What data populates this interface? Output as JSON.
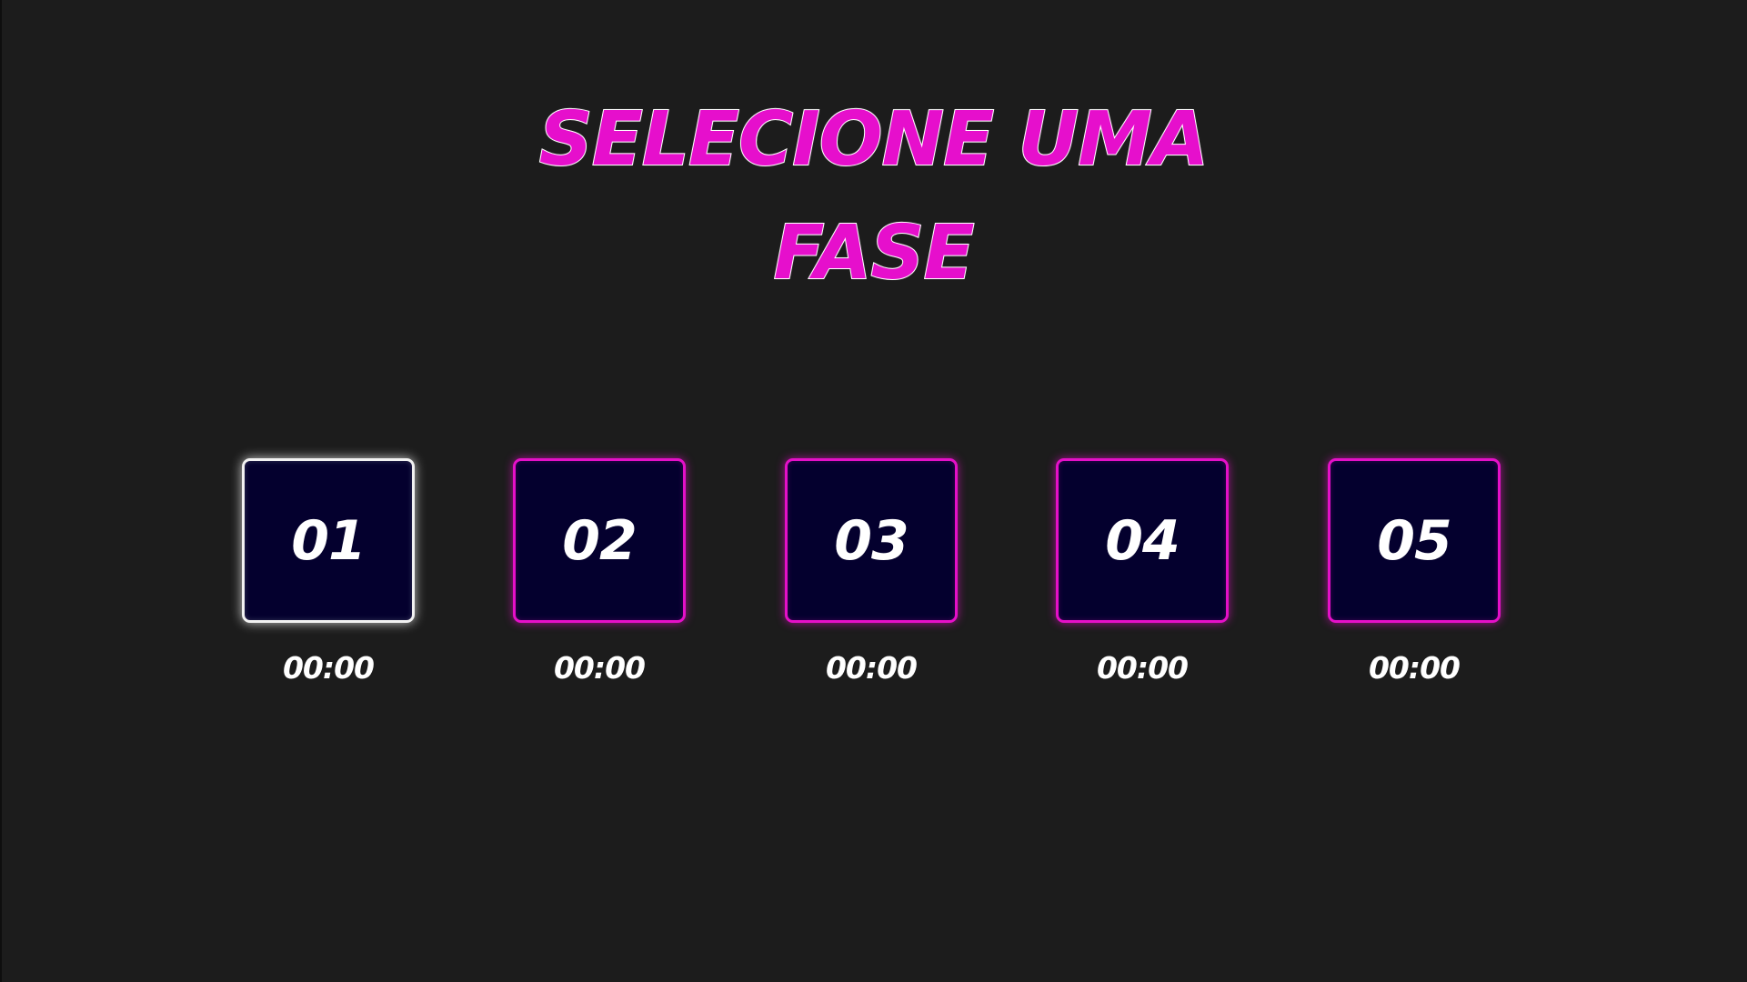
{
  "title": {
    "line1": "SELECIONE UMA",
    "line2": "FASE"
  },
  "colors": {
    "background": "#1c1c1c",
    "accent": "#e510c8",
    "box_fill": "#04002e",
    "selected_border": "#f2f2f2",
    "text": "#ffffff"
  },
  "levels": [
    {
      "number": "01",
      "time": "00:00",
      "selected": true
    },
    {
      "number": "02",
      "time": "00:00",
      "selected": false
    },
    {
      "number": "03",
      "time": "00:00",
      "selected": false
    },
    {
      "number": "04",
      "time": "00:00",
      "selected": false
    },
    {
      "number": "05",
      "time": "00:00",
      "selected": false
    }
  ]
}
